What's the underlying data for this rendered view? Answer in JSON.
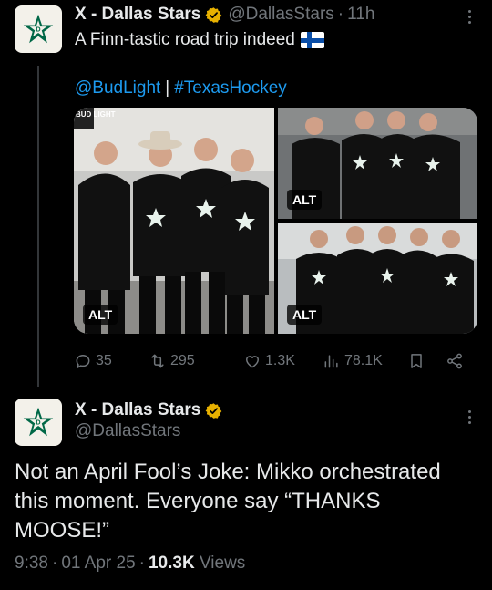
{
  "tweet1": {
    "author_name": "X - Dallas Stars",
    "handle": "@DallasStars",
    "time": "11h",
    "text": "A Finn-tastic road trip indeed",
    "links": [
      "@BudLight",
      "#TexasHockey"
    ],
    "link_separator": "|",
    "media": [
      {
        "alt_label": "ALT",
        "watermark": "BUD LIGHT"
      },
      {
        "alt_label": "ALT"
      },
      {
        "alt_label": "ALT"
      }
    ],
    "actions": {
      "replies": "35",
      "reposts": "295",
      "likes": "1.3K",
      "views": "78.1K"
    }
  },
  "tweet2": {
    "author_name": "X - Dallas Stars",
    "handle": "@DallasStars",
    "text": "Not an April Fool’s Joke: Mikko orchestrated this moment. Everyone say “THANKS MOOSE!”",
    "time": "9:38",
    "date": "01 Apr 25",
    "views_count": "10.3K",
    "views_label": "Views"
  },
  "colors": {
    "background": "#000000",
    "text": "#e7e9ea",
    "muted": "#71767b",
    "link": "#1d9bf0",
    "verified": "#e8b100",
    "brand_green": "#006847"
  }
}
